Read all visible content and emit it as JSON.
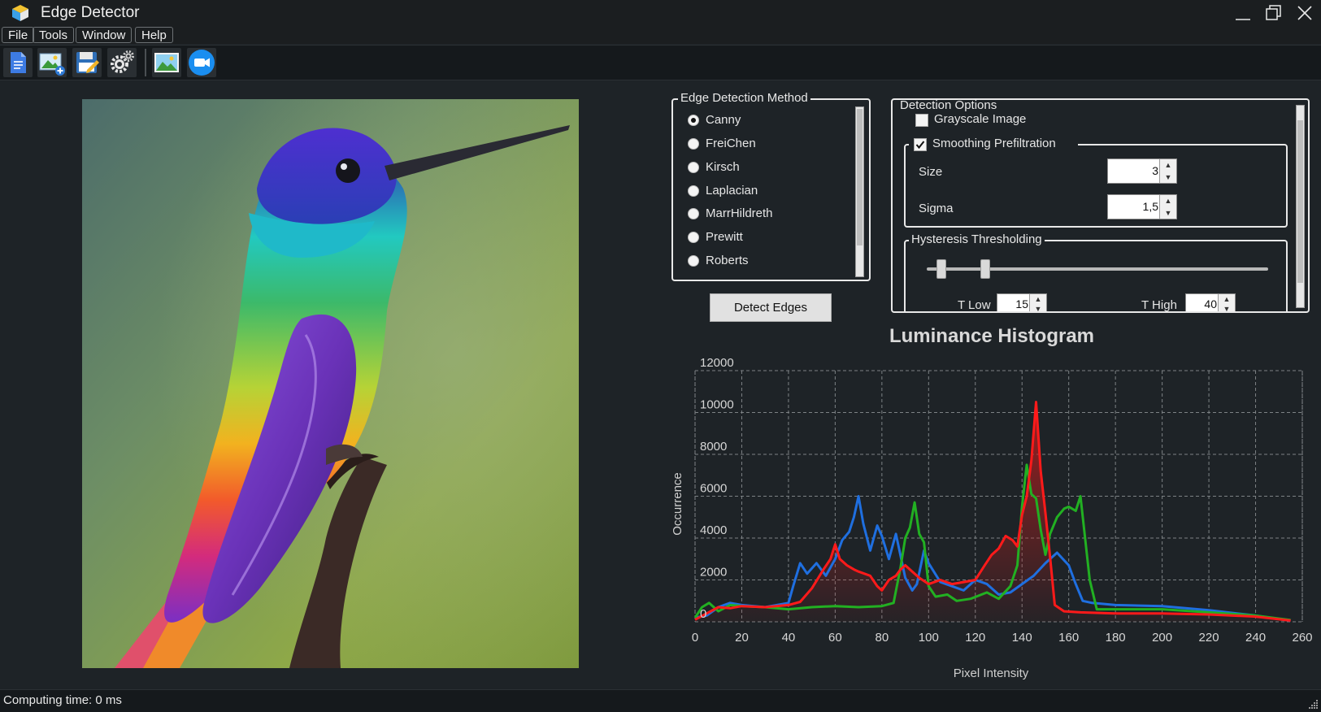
{
  "window": {
    "title": "Edge Detector",
    "icon": "app-cube-icon"
  },
  "menu": [
    "File",
    "Tools",
    "Window",
    "Help"
  ],
  "toolbar": {
    "buttons": [
      "new-document-icon",
      "open-image-icon",
      "save-icon",
      "settings-gears-icon",
      "image-icon",
      "camera-icon"
    ]
  },
  "image_view": {
    "content": "hummingbird-photo"
  },
  "edge_method": {
    "title": "Edge Detection Method",
    "options": [
      "Canny",
      "FreiChen",
      "Kirsch",
      "Laplacian",
      "MarrHildreth",
      "Prewitt",
      "Roberts"
    ],
    "selected": "Canny"
  },
  "detect_button": "Detect Edges",
  "detection_options": {
    "title": "Detection Options",
    "grayscale": {
      "label": "Grayscale Image",
      "checked": false
    },
    "smoothing": {
      "label": "Smoothing Prefiltration",
      "checked": true,
      "size_label": "Size",
      "size_value": "3",
      "sigma_label": "Sigma",
      "sigma_value": "1,5"
    },
    "hysteresis": {
      "title": "Hysteresis Thresholding",
      "t_low_label": "T Low",
      "t_low_value": "15",
      "t_high_label": "T High",
      "t_high_value": "40"
    }
  },
  "chart_data": {
    "type": "line",
    "title": "Luminance Histogram",
    "xlabel": "Pixel Intensity",
    "ylabel": "Occurrence",
    "xlim": [
      0,
      260
    ],
    "ylim": [
      0,
      12000
    ],
    "xticks": [
      0,
      20,
      40,
      60,
      80,
      100,
      120,
      140,
      160,
      180,
      200,
      220,
      240,
      260
    ],
    "yticks": [
      0,
      2000,
      4000,
      6000,
      8000,
      10000,
      12000
    ],
    "grid": true,
    "series": [
      {
        "color": "#1f6fe0",
        "points": [
          [
            0,
            200
          ],
          [
            5,
            300
          ],
          [
            10,
            700
          ],
          [
            15,
            900
          ],
          [
            20,
            800
          ],
          [
            30,
            700
          ],
          [
            40,
            900
          ],
          [
            42,
            1700
          ],
          [
            45,
            2800
          ],
          [
            48,
            2300
          ],
          [
            52,
            2800
          ],
          [
            56,
            2200
          ],
          [
            60,
            3000
          ],
          [
            63,
            3900
          ],
          [
            66,
            4300
          ],
          [
            68,
            5000
          ],
          [
            70,
            6000
          ],
          [
            72,
            4700
          ],
          [
            75,
            3400
          ],
          [
            78,
            4600
          ],
          [
            80,
            4100
          ],
          [
            83,
            3000
          ],
          [
            86,
            4200
          ],
          [
            90,
            2100
          ],
          [
            93,
            1500
          ],
          [
            95,
            1800
          ],
          [
            98,
            3400
          ],
          [
            100,
            2800
          ],
          [
            105,
            1900
          ],
          [
            110,
            1700
          ],
          [
            115,
            1500
          ],
          [
            120,
            2000
          ],
          [
            125,
            1800
          ],
          [
            130,
            1300
          ],
          [
            135,
            1400
          ],
          [
            140,
            1800
          ],
          [
            145,
            2200
          ],
          [
            150,
            2800
          ],
          [
            155,
            3300
          ],
          [
            160,
            2700
          ],
          [
            163,
            1800
          ],
          [
            166,
            1000
          ],
          [
            170,
            900
          ],
          [
            180,
            800
          ],
          [
            200,
            750
          ],
          [
            220,
            550
          ],
          [
            240,
            300
          ],
          [
            255,
            50
          ]
        ]
      },
      {
        "color": "#22b022",
        "points": [
          [
            0,
            200
          ],
          [
            3,
            700
          ],
          [
            6,
            900
          ],
          [
            10,
            500
          ],
          [
            15,
            800
          ],
          [
            20,
            750
          ],
          [
            30,
            700
          ],
          [
            40,
            600
          ],
          [
            50,
            700
          ],
          [
            60,
            750
          ],
          [
            70,
            700
          ],
          [
            80,
            750
          ],
          [
            85,
            900
          ],
          [
            88,
            2600
          ],
          [
            90,
            4000
          ],
          [
            92,
            4500
          ],
          [
            94,
            5700
          ],
          [
            96,
            4200
          ],
          [
            98,
            3800
          ],
          [
            100,
            1700
          ],
          [
            103,
            1200
          ],
          [
            108,
            1300
          ],
          [
            112,
            1000
          ],
          [
            118,
            1100
          ],
          [
            125,
            1400
          ],
          [
            130,
            1100
          ],
          [
            135,
            1700
          ],
          [
            138,
            2700
          ],
          [
            140,
            5500
          ],
          [
            142,
            7500
          ],
          [
            144,
            6100
          ],
          [
            146,
            5900
          ],
          [
            148,
            4400
          ],
          [
            150,
            3200
          ],
          [
            152,
            4200
          ],
          [
            155,
            5000
          ],
          [
            158,
            5400
          ],
          [
            160,
            5500
          ],
          [
            163,
            5300
          ],
          [
            165,
            6000
          ],
          [
            167,
            4000
          ],
          [
            169,
            2000
          ],
          [
            172,
            600
          ],
          [
            180,
            600
          ],
          [
            200,
            600
          ],
          [
            220,
            450
          ],
          [
            240,
            300
          ],
          [
            255,
            80
          ]
        ]
      },
      {
        "color": "#ff1a1a",
        "points": [
          [
            0,
            100
          ],
          [
            5,
            400
          ],
          [
            10,
            700
          ],
          [
            15,
            650
          ],
          [
            20,
            750
          ],
          [
            30,
            700
          ],
          [
            40,
            800
          ],
          [
            45,
            950
          ],
          [
            50,
            1600
          ],
          [
            55,
            2500
          ],
          [
            58,
            3000
          ],
          [
            60,
            3700
          ],
          [
            62,
            3000
          ],
          [
            65,
            2700
          ],
          [
            68,
            2500
          ],
          [
            70,
            2400
          ],
          [
            75,
            2200
          ],
          [
            78,
            1700
          ],
          [
            80,
            1500
          ],
          [
            83,
            2000
          ],
          [
            86,
            2200
          ],
          [
            88,
            2500
          ],
          [
            90,
            2700
          ],
          [
            93,
            2400
          ],
          [
            96,
            2100
          ],
          [
            100,
            1800
          ],
          [
            105,
            2000
          ],
          [
            110,
            1800
          ],
          [
            115,
            1900
          ],
          [
            120,
            2000
          ],
          [
            124,
            2700
          ],
          [
            127,
            3200
          ],
          [
            130,
            3500
          ],
          [
            133,
            4100
          ],
          [
            136,
            3900
          ],
          [
            138,
            3600
          ],
          [
            140,
            5100
          ],
          [
            142,
            6000
          ],
          [
            144,
            7700
          ],
          [
            146,
            10500
          ],
          [
            148,
            7200
          ],
          [
            150,
            5200
          ],
          [
            152,
            3100
          ],
          [
            154,
            800
          ],
          [
            158,
            500
          ],
          [
            165,
            450
          ],
          [
            180,
            400
          ],
          [
            200,
            400
          ],
          [
            220,
            350
          ],
          [
            240,
            250
          ],
          [
            255,
            60
          ]
        ]
      }
    ]
  }
}
